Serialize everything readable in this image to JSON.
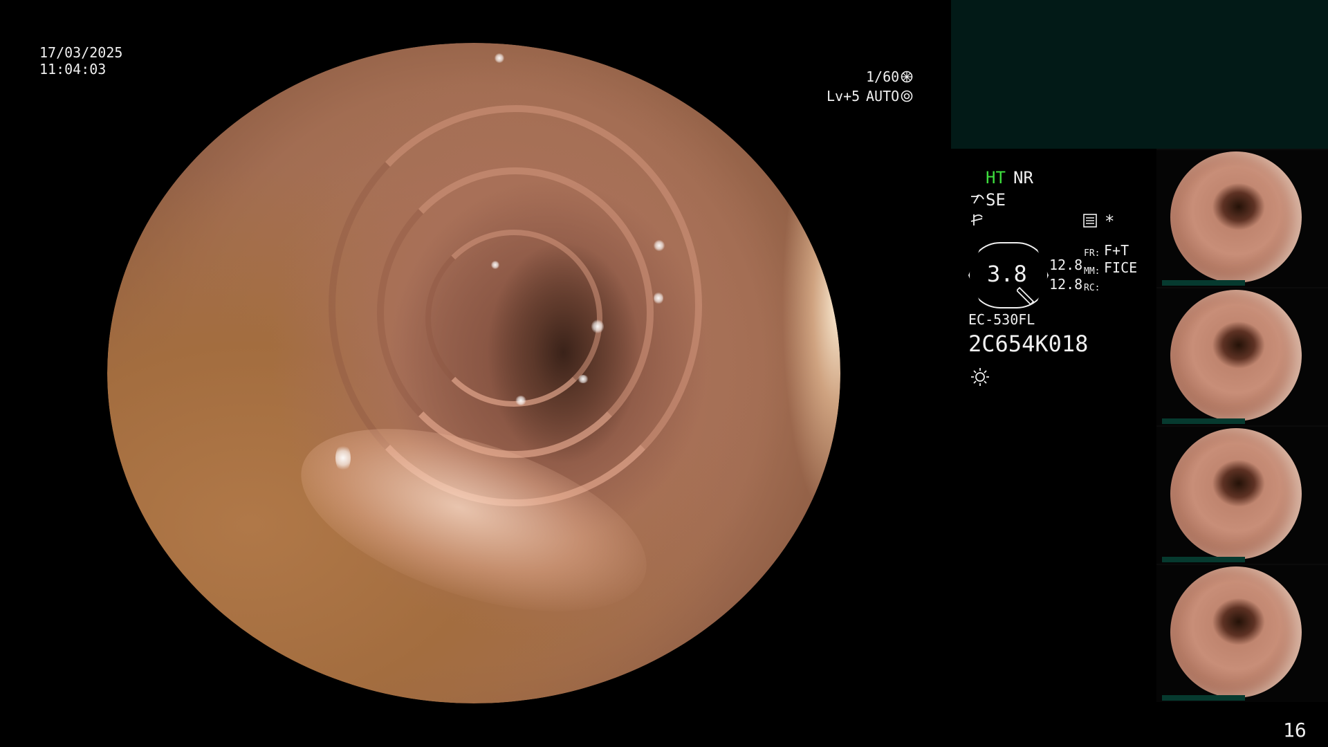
{
  "overlay": {
    "date": "17/03/2025",
    "time": "11:04:03",
    "shutter": "1/60",
    "level": "Lv+5",
    "iris_mode": "AUTO"
  },
  "settings": {
    "ht": "HT",
    "nr": "NR",
    "se": "SE",
    "gauge_value": "3.8",
    "val_top": "12.8",
    "val_bottom": "12.8",
    "fr_label": "FR:",
    "fr_value": "F+T",
    "mm_label": "MM:",
    "mm_value": "FICE",
    "rc_label": "RC:",
    "asterisk": "*",
    "model": "EC-530FL",
    "serial": "2C654K018"
  },
  "page_number": "16",
  "colors": {
    "ht_green": "#3ee03e",
    "panel_teal": "#021a17",
    "text": "#f0f0f0"
  },
  "icons": [
    "shutter-icon",
    "iris-icon",
    "se-icon",
    "enhance-icon",
    "memo-icon",
    "light-icon"
  ]
}
